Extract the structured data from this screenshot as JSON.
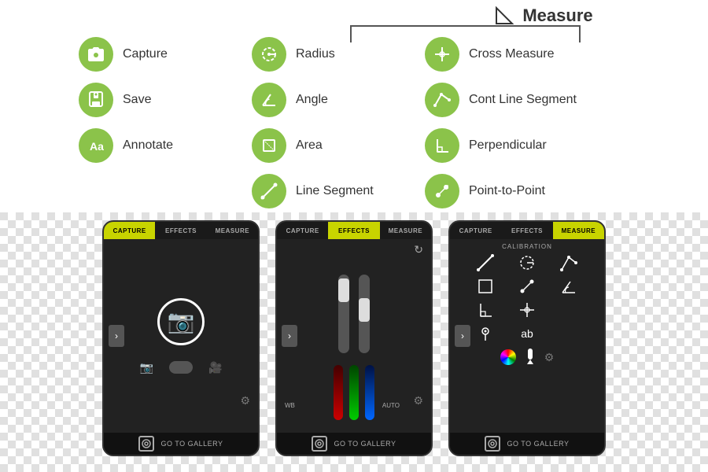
{
  "header": {
    "measure_label": "Measure"
  },
  "tools": {
    "column1": [
      {
        "id": "capture",
        "label": "Capture",
        "icon": "camera"
      },
      {
        "id": "save",
        "label": "Save",
        "icon": "save"
      },
      {
        "id": "annotate",
        "label": "Annotate",
        "icon": "annotate"
      }
    ],
    "column2": [
      {
        "id": "radius",
        "label": "Radius",
        "icon": "radius"
      },
      {
        "id": "angle",
        "label": "Angle",
        "icon": "angle"
      },
      {
        "id": "area",
        "label": "Area",
        "icon": "area"
      },
      {
        "id": "line-segment",
        "label": "Line Segment",
        "icon": "line-segment"
      }
    ],
    "column3": [
      {
        "id": "cross-measure",
        "label": "Cross Measure",
        "icon": "cross-measure"
      },
      {
        "id": "cont-line-segment",
        "label": "Cont Line Segment",
        "icon": "cont-line"
      },
      {
        "id": "perpendicular",
        "label": "Perpendicular",
        "icon": "perpendicular"
      },
      {
        "id": "point-to-point",
        "label": "Point-to-Point",
        "icon": "point-to-point"
      }
    ]
  },
  "phones": {
    "phone1": {
      "tabs": [
        "CAPTURE",
        "EFFECTS",
        "MEASURE"
      ],
      "active_tab": "CAPTURE"
    },
    "phone2": {
      "tabs": [
        "CAPTURE",
        "EFFECTS",
        "MEASURE"
      ],
      "active_tab": "EFFECTS",
      "wb_label": "WB",
      "auto_label": "AUTO"
    },
    "phone3": {
      "tabs": [
        "CAPTURE",
        "EFFECTS",
        "MEASURE"
      ],
      "active_tab": "MEASURE",
      "calibration_label": "CALIBRATION"
    }
  },
  "gallery_label": "GO TO GALLERY"
}
